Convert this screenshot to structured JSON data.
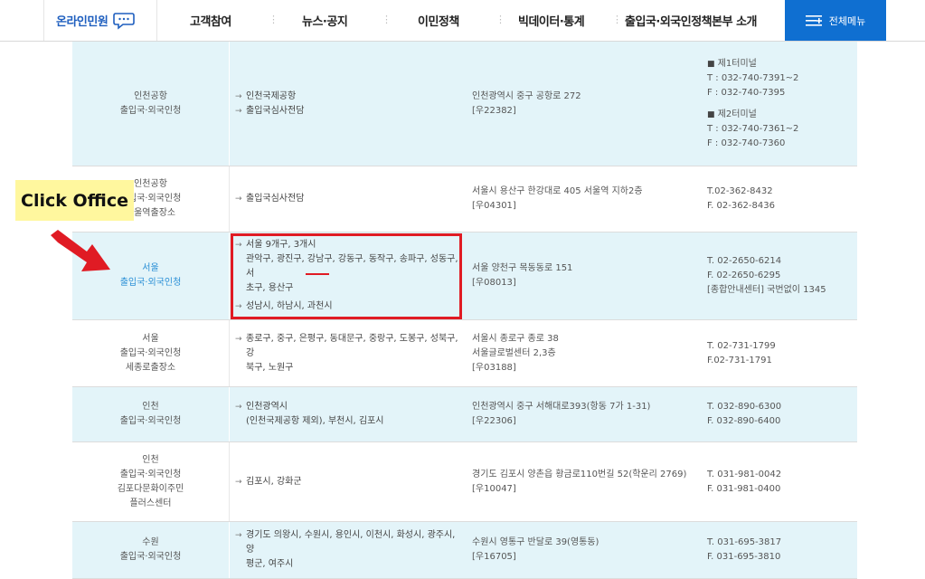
{
  "header": {
    "brand": "온라인민원",
    "nav": [
      "고객참여",
      "뉴스·공지",
      "이민정책",
      "빅데이터·통계",
      "출입국·외국인정책본부 소개"
    ],
    "menu_label": "전체메뉴"
  },
  "rows": [
    {
      "name": [
        "인천공항",
        "출입국·외국인청"
      ],
      "area": [
        "인천국제공항",
        "출입국심사전담"
      ],
      "addr": [
        "인천광역시 중구 공항로 272",
        "[우22382]"
      ],
      "tel1_title": "제1터미널",
      "tel1": [
        "T : 032-740-7391~2",
        "F : 032-740-7395"
      ],
      "tel2_title": "제2터미널",
      "tel2": [
        "T : 032-740-7361~2",
        "F : 032-740-7360"
      ]
    },
    {
      "name": [
        "인천공항",
        "출입국·외국인청",
        "서울역출장소"
      ],
      "area": [
        "출입국심사전담"
      ],
      "addr": [
        "서울시 용산구 한강대로 405 서울역 지하2층",
        "[우04301]"
      ],
      "tel": [
        "T.02-362-8432",
        "F. 02-362-8436"
      ]
    },
    {
      "name": [
        "서울",
        "출입국·외국인청"
      ],
      "area_a": [
        "서울 9개구, 3개시",
        "관악구, 광진구, 강남구, 강동구, 동작구, 송파구, 성동구, 서",
        "초구, 용산구"
      ],
      "area_b": "성남시, 하남시, 과천시",
      "addr": [
        "서울 양천구 목동동로 151",
        "[우08013]"
      ],
      "tel": [
        "T. 02-2650-6214",
        "F. 02-2650-6295",
        "[종합안내센터] 국번없이 1345"
      ]
    },
    {
      "name": [
        "서울",
        "출입국·외국인청",
        "세종로출장소"
      ],
      "area": [
        "종로구, 중구, 은평구, 동대문구, 중랑구, 도봉구, 성북구, 강",
        "북구, 노원구"
      ],
      "addr": [
        "서울시 종로구 종로 38",
        "서울글로벌센터 2,3층",
        "[우03188]"
      ],
      "tel": [
        "T. 02-731-1799",
        "F.02-731-1791"
      ]
    },
    {
      "name": [
        "인천",
        "출입국·외국인청"
      ],
      "area": [
        "인천광역시",
        "(인천국제공항 제외), 부천시, 김포시"
      ],
      "addr": [
        "인천광역시 중구 서해대로393(항동 7가 1-31)",
        "[우22306]"
      ],
      "tel": [
        "T. 032-890-6300",
        "F. 032-890-6400"
      ]
    },
    {
      "name": [
        "인천",
        "출입국·외국인청",
        "김포다문화이주민",
        "플러스센터"
      ],
      "area": [
        "김포시, 강화군"
      ],
      "addr": [
        "경기도 김포시 양촌읍 황금로110번길 52(학운리 2769)",
        "[우10047]"
      ],
      "tel": [
        "T. 031-981-0042",
        "F. 031-981-0400"
      ]
    },
    {
      "name": [
        "수원",
        "출입국·외국인청"
      ],
      "area": [
        "경기도 의왕시, 수원시, 용인시, 이천시, 화성시, 광주시, 양",
        "평군, 여주시"
      ],
      "addr": [
        "수원시 영통구 반달로 39(영통동)",
        "[우16705]"
      ],
      "tel": [
        "T. 031-695-3817",
        "F. 031-695-3810"
      ]
    }
  ],
  "annotation": {
    "callout": "Click Office"
  }
}
